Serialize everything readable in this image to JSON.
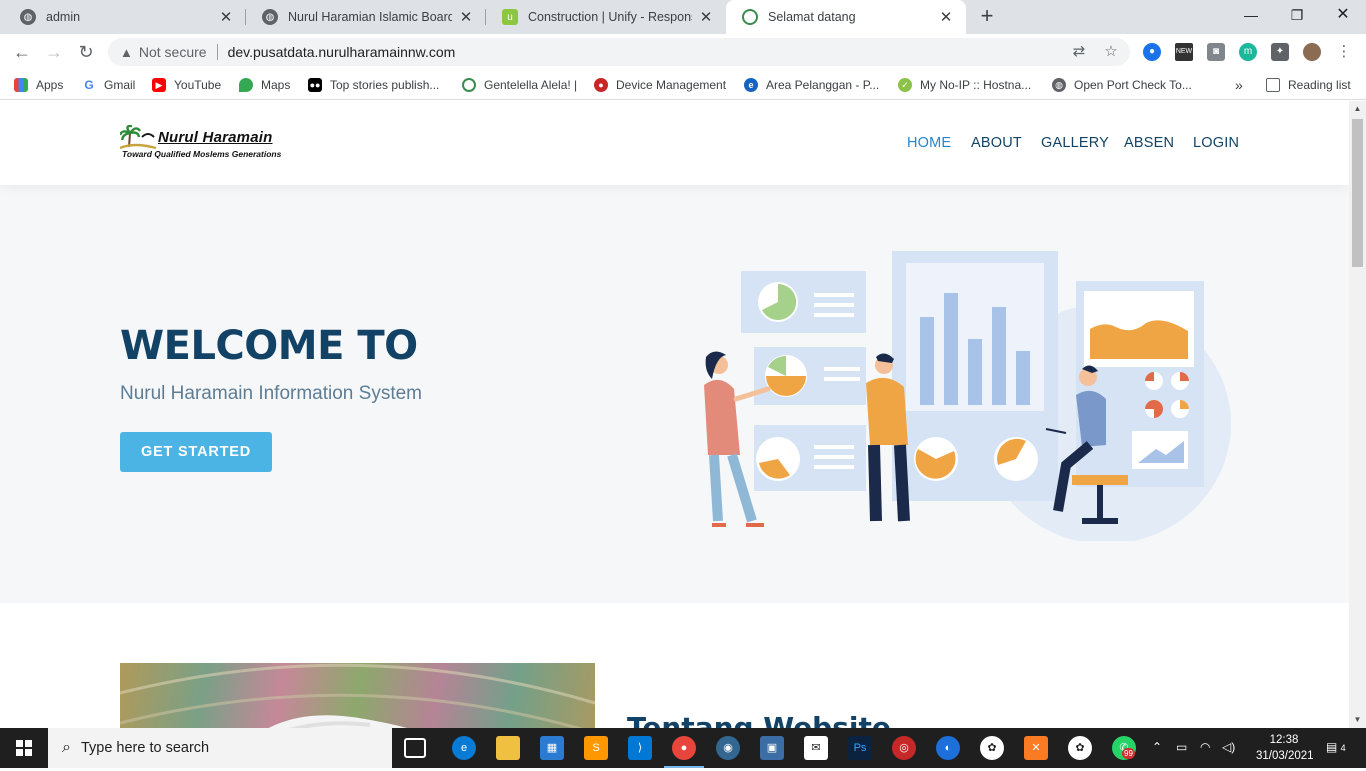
{
  "browser": {
    "tabs": [
      {
        "title": "admin",
        "icon": "globe-icon",
        "active": false
      },
      {
        "title": "Nurul Haramian Islamic Boarding",
        "icon": "globe-icon",
        "active": false
      },
      {
        "title": "Construction | Unify - Responsive",
        "icon": "unify-icon",
        "active": false
      },
      {
        "title": "Selamat datang",
        "icon": "nurul-haramain-icon",
        "active": true
      }
    ],
    "not_secure_label": "Not secure",
    "url": "dev.pusatdata.nurulharamainnw.com",
    "bookmarks": [
      {
        "label": "Apps",
        "icon": "apps-grid-icon"
      },
      {
        "label": "Gmail",
        "icon": "google-icon"
      },
      {
        "label": "YouTube",
        "icon": "youtube-icon"
      },
      {
        "label": "Maps",
        "icon": "maps-pin-icon"
      },
      {
        "label": "Top stories publish...",
        "icon": "medium-icon"
      },
      {
        "label": "Gentelella Alela! |",
        "icon": "nurul-haramain-icon"
      },
      {
        "label": "Device Management",
        "icon": "device-management-icon"
      },
      {
        "label": "Area Pelanggan - P...",
        "icon": "edge-icon"
      },
      {
        "label": "My No-IP :: Hostna...",
        "icon": "noip-icon"
      },
      {
        "label": "Open Port Check To...",
        "icon": "globe-icon"
      }
    ],
    "more_bookmarks": "»",
    "reading_list": "Reading list"
  },
  "site": {
    "logo": {
      "name": "Nurul Haramain",
      "tagline": "Toward Qualified Moslems Generations"
    },
    "menu": [
      {
        "label": "HOME",
        "active": true
      },
      {
        "label": "ABOUT",
        "active": false
      },
      {
        "label": "GALLERY",
        "active": false
      },
      {
        "label": "ABSEN",
        "active": false
      },
      {
        "label": "LOGIN",
        "active": false
      }
    ],
    "hero": {
      "title": "WELCOME TO",
      "subtitle": "Nurul Haramain Information System",
      "button": "GET STARTED"
    },
    "about": {
      "title": "Tentang Website"
    },
    "colors": {
      "primary": "#124265",
      "accent": "#2487ce",
      "button": "#4cb4e4"
    }
  },
  "taskbar": {
    "search_placeholder": "Type here to search",
    "time": "12:38",
    "date": "31/03/2021",
    "whatsapp_badge": "99",
    "notifications": "4"
  }
}
